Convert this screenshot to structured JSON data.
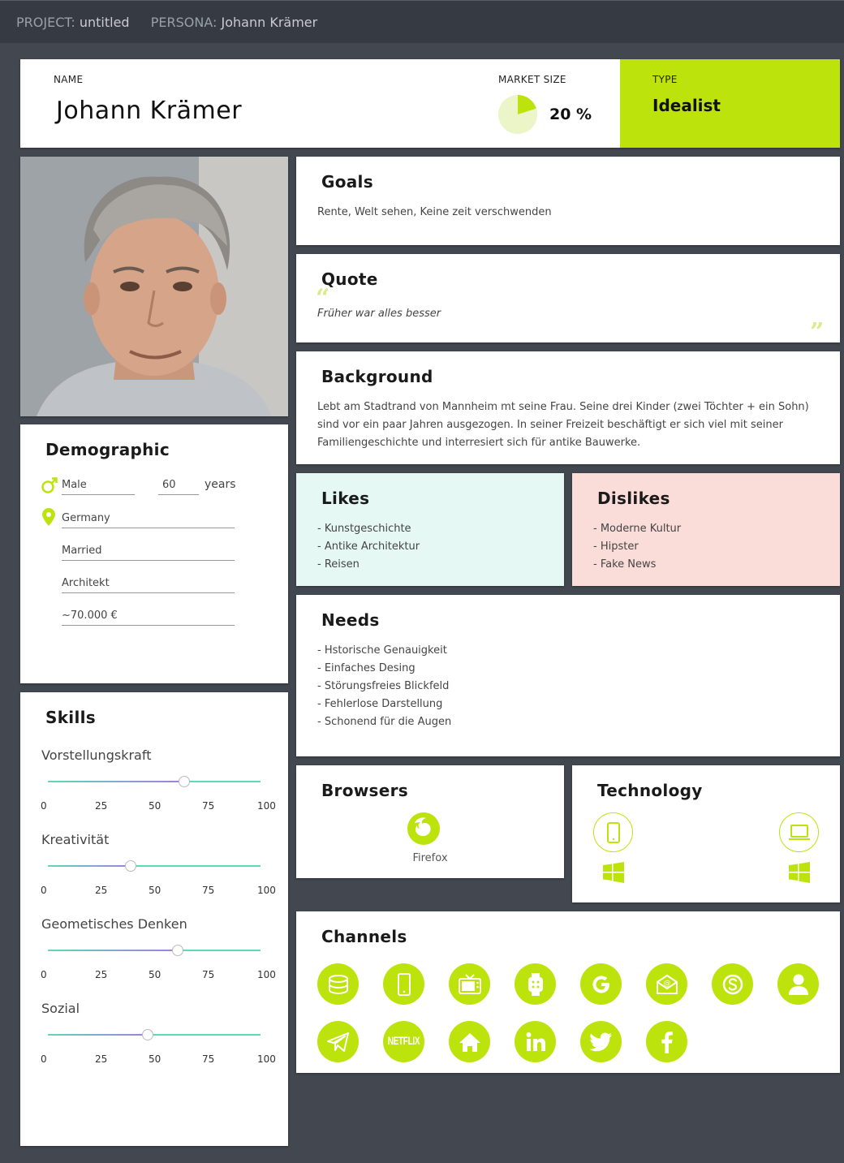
{
  "topbar": {
    "project_label": "PROJECT:",
    "project_value": "untitled",
    "persona_label": "PERSONA:",
    "persona_value": "Johann Krämer"
  },
  "header": {
    "name_label": "NAME",
    "name": "Johann Krämer",
    "market_label": "MARKET SIZE",
    "market_value": "20 %",
    "market_fraction": 0.2,
    "type_label": "TYPE",
    "type": "Idealist"
  },
  "goals": {
    "title": "Goals",
    "text": "Rente, Welt sehen, Keine zeit verschwenden"
  },
  "quote": {
    "title": "Quote",
    "text": "Früher war alles besser",
    "open": "“",
    "close": "”"
  },
  "background": {
    "title": "Background",
    "text": "Lebt am Stadtrand von Mannheim mt seine Frau. Seine  drei Kinder (zwei Töchter + ein Sohn) sind vor ein paar Jahren ausgezogen. In seiner Freizeit beschäftigt er sich viel mit seiner Familiengeschichte und interresiert sich für antike Bauwerke."
  },
  "likes": {
    "title": "Likes",
    "items": [
      "- Kunstgeschichte",
      "- Antike Architektur",
      "- Reisen"
    ]
  },
  "dislikes": {
    "title": "Dislikes",
    "items": [
      "- Moderne Kultur",
      "- Hipster",
      "- Fake News"
    ]
  },
  "needs": {
    "title": "Needs",
    "items": [
      "- Hstorische Genauigkeit",
      "- Einfaches Desing",
      "- Störungsfreies Blickfeld",
      "- Fehlerlose Darstellung",
      "- Schonend für die  Augen"
    ]
  },
  "demographic": {
    "title": "Demographic",
    "gender": "Male",
    "age": "60",
    "age_unit": "years",
    "country": "Germany",
    "status": "Married",
    "job": "Architekt",
    "income": "~70.000 €"
  },
  "skills": {
    "title": "Skills",
    "tick_labels": [
      "0",
      "25",
      "50",
      "75",
      "100"
    ],
    "items": [
      {
        "name": "Vorstellungskraft",
        "value": 64
      },
      {
        "name": "Kreativität",
        "value": 39
      },
      {
        "name": "Geometisches Denken",
        "value": 61
      },
      {
        "name": "Sozial",
        "value": 47
      }
    ]
  },
  "browsers": {
    "title": "Browsers",
    "items": [
      {
        "label": "Firefox",
        "icon": "firefox-icon"
      }
    ]
  },
  "technology": {
    "title": "Technology",
    "devices": [
      "smartphone-icon",
      "laptop-icon"
    ],
    "os": [
      "windows-icon",
      "windows-icon"
    ]
  },
  "channels": {
    "title": "Channels",
    "icons": [
      "database-icon",
      "smartphone-icon",
      "tv-icon",
      "smartwatch-icon",
      "google-icon",
      "email-icon",
      "skype-icon",
      "person-icon",
      "telegram-icon",
      "netflix-icon",
      "home-icon",
      "linkedin-icon",
      "twitter-icon",
      "facebook-icon"
    ],
    "netflix_text": "NETFLIX"
  },
  "colors": {
    "accent": "#bce30c",
    "likes_bg": "#e5f8f3",
    "dislikes_bg": "#fadcd9",
    "slider": "#5fd8b8"
  }
}
